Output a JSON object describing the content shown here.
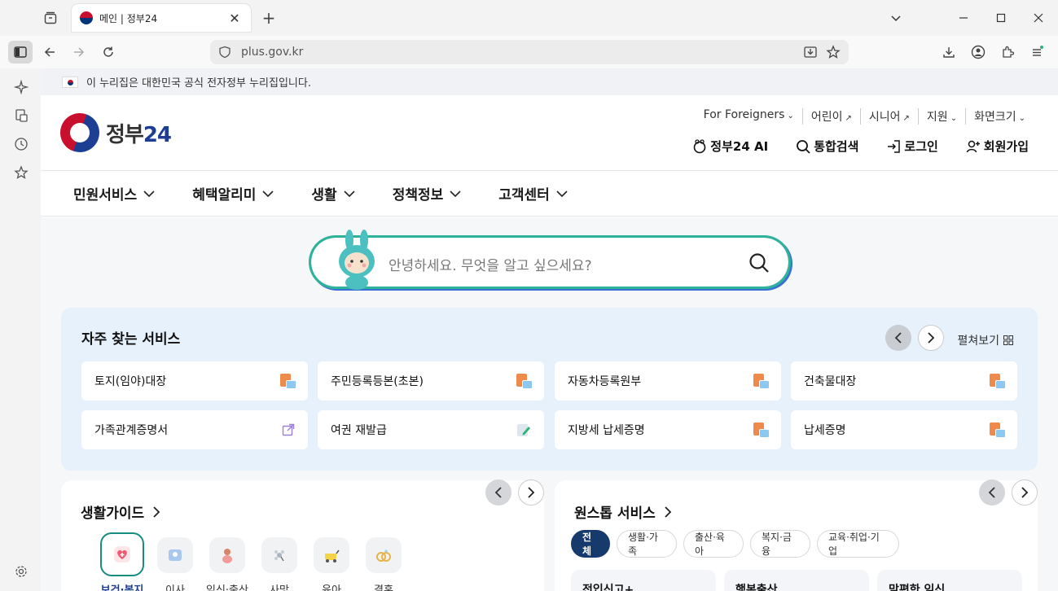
{
  "browser": {
    "tab_title": "메인 | 정부24",
    "url": "plus.gov.kr"
  },
  "gov_notice": "이 누리집은 대한민국 공식 전자정부 누리집입니다.",
  "header": {
    "logo_text_a": "정부",
    "logo_text_b": "24",
    "util": [
      "For Foreigners",
      "어린이",
      "시니어",
      "지원",
      "화면크기"
    ],
    "actions": [
      "정부24 AI",
      "통합검색",
      "로그인",
      "회원가입"
    ]
  },
  "gnb": [
    "민원서비스",
    "혜택알리미",
    "생활",
    "정책정보",
    "고객센터"
  ],
  "search": {
    "placeholder": "안녕하세요. 무엇을 알고 싶으세요?"
  },
  "frequent": {
    "title": "자주 찾는 서비스",
    "expand": "펼쳐보기",
    "items": [
      "토지(임야)대장",
      "주민등록등본(초본)",
      "자동차등록원부",
      "건축물대장",
      "가족관계증명서",
      "여권 재발급",
      "지방세 납세증명",
      "납세증명"
    ]
  },
  "life_guide": {
    "title": "생활가이드",
    "items": [
      "보건·복지",
      "이사",
      "임신·출산",
      "사망",
      "육아",
      "결혼"
    ]
  },
  "onestop": {
    "title": "원스톱 서비스",
    "chips": [
      "전체",
      "생활·가족",
      "출산·육아",
      "복지·금융",
      "교육·취업·기업"
    ],
    "cards": [
      "전입신고+",
      "행복출산",
      "맘편한 임신"
    ]
  }
}
